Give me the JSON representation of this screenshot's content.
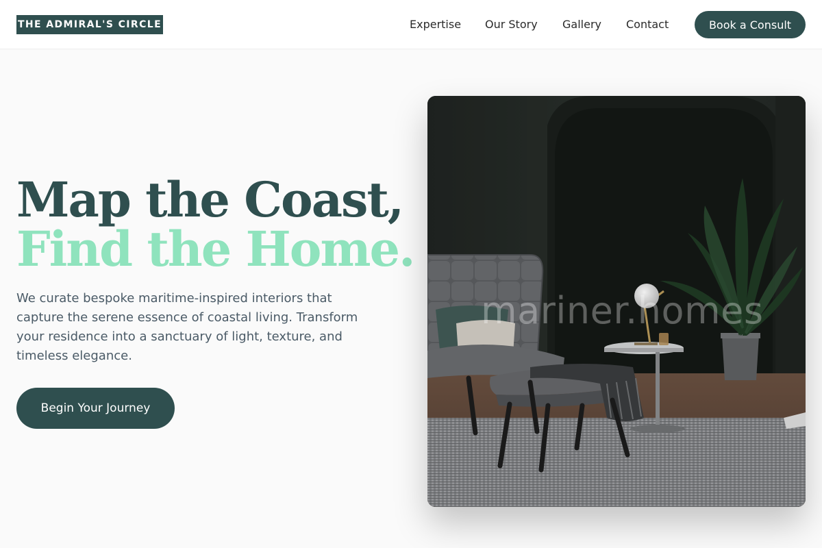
{
  "header": {
    "logo": "THE ADMIRAL'S CIRCLE",
    "nav": [
      "Expertise",
      "Our Story",
      "Gallery",
      "Contact"
    ],
    "cta": "Book a Consult"
  },
  "hero": {
    "headline_line1": "Map the Coast,",
    "headline_line2": "Find the Home.",
    "description": "We curate bespoke maritime-inspired interiors that capture the serene essence of coastal living. Transform your residence into a sanctuary of light, texture, and timeless elegance.",
    "button": "Begin Your Journey",
    "image_watermark": "mariner.homes"
  },
  "colors": {
    "primary": "#2f4f4f",
    "accent": "#8fe3bd",
    "page_background": "#fafafa",
    "body_text": "#4a5a66"
  }
}
